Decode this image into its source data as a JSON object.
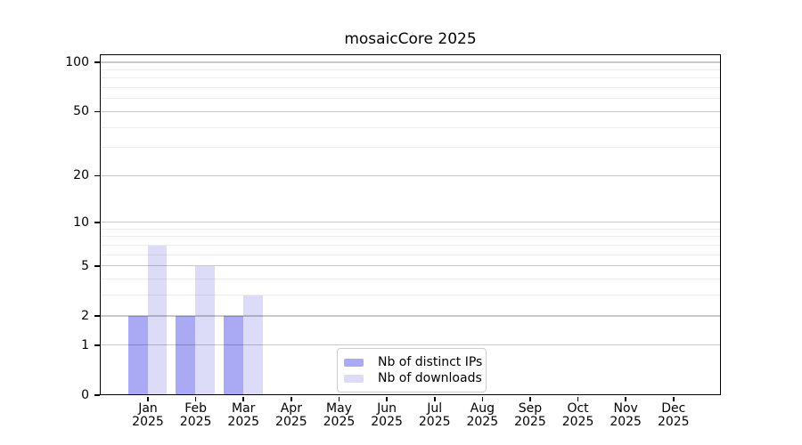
{
  "title": "mosaicCore 2025",
  "colors": {
    "distinct_ips": "#a9a9f4",
    "downloads": "#dcdcf8",
    "major_grid": "#c9c9c9",
    "minor_grid": "#ededed",
    "axis": "#000000",
    "text": "#000000",
    "legend_border": "#cccccc",
    "background": "#ffffff"
  },
  "chart_data": {
    "type": "bar",
    "title": "mosaicCore 2025",
    "categories": [
      "Jan 2025",
      "Feb 2025",
      "Mar 2025",
      "Apr 2025",
      "May 2025",
      "Jun 2025",
      "Jul 2025",
      "Aug 2025",
      "Sep 2025",
      "Oct 2025",
      "Nov 2025",
      "Dec 2025"
    ],
    "month_labels": [
      "Jan",
      "Feb",
      "Mar",
      "Apr",
      "May",
      "Jun",
      "Jul",
      "Aug",
      "Sep",
      "Oct",
      "Nov",
      "Dec"
    ],
    "year_label": "2025",
    "series": [
      {
        "name": "Nb of distinct IPs",
        "color": "#a9a9f4",
        "values": [
          2,
          2,
          2,
          0,
          0,
          0,
          0,
          0,
          0,
          0,
          0,
          0
        ]
      },
      {
        "name": "Nb of downloads",
        "color": "#dcdcf8",
        "values": [
          7,
          5,
          3,
          0,
          0,
          0,
          0,
          0,
          0,
          0,
          0,
          0
        ]
      }
    ],
    "xlabel": "",
    "ylabel": "",
    "yscale": "log10(1+x)",
    "ylim": [
      0,
      112
    ],
    "y_major_ticks": [
      0,
      1,
      2,
      5,
      10,
      20,
      50,
      100
    ],
    "y_minor_ticks": [
      3,
      4,
      6,
      7,
      8,
      9,
      30,
      40,
      60,
      70,
      80,
      90
    ],
    "grid": true,
    "legend_position": "lower center"
  }
}
